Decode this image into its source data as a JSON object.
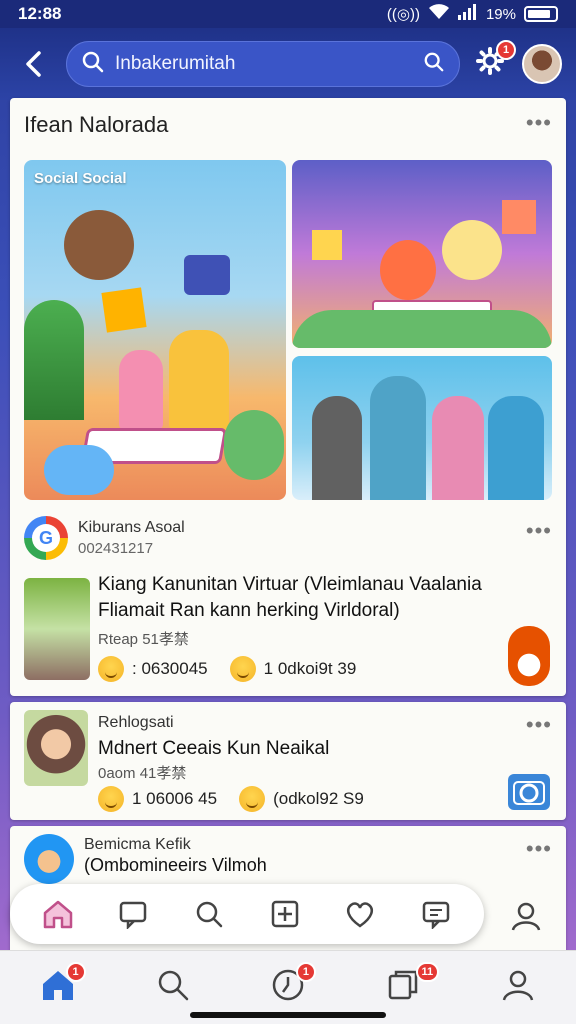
{
  "status_bar": {
    "time": "12:88",
    "battery_text": "19%"
  },
  "header": {
    "search_text": "Inbakerumitah",
    "settings_badge": "1"
  },
  "feed_card": {
    "title": "Ifean Nalorada",
    "image_label": "Social Social",
    "post": {
      "author": "Kiburans Asoal",
      "id_line": "002431217",
      "text_line1": "Kiang Kanunitan Virtuar (Vleimlanau Vaalania",
      "text_line2": "Fliamait Ran kann herking Virldoral)",
      "meta": "Rteap 51孝禁",
      "react1_count": ": 0630045",
      "react2_count": "1 0dkoi9t 39"
    }
  },
  "post2": {
    "author": "Rehlogsati",
    "text": "Mdnert Ceeais Kun Neaikal",
    "meta": "0aom 41孝禁",
    "react1_count": "1 06006 45",
    "react2_count": "(odkol92 S9"
  },
  "post3": {
    "author": "Bemicma Kefik",
    "text": "(Ombomineeirs Vilmoh"
  },
  "tab_bar": {
    "home_badge": "1",
    "clock_badge": "1",
    "pages_badge": "11"
  },
  "colors": {
    "header_bg": "#2c43a6",
    "badge_red": "#e53935",
    "accent_pink": "#c0508a"
  },
  "icons": [
    "back-icon",
    "search-icon",
    "gear-icon",
    "home-icon",
    "chat-icon",
    "plus-icon",
    "heart-icon",
    "profile-icon",
    "camera-icon"
  ]
}
